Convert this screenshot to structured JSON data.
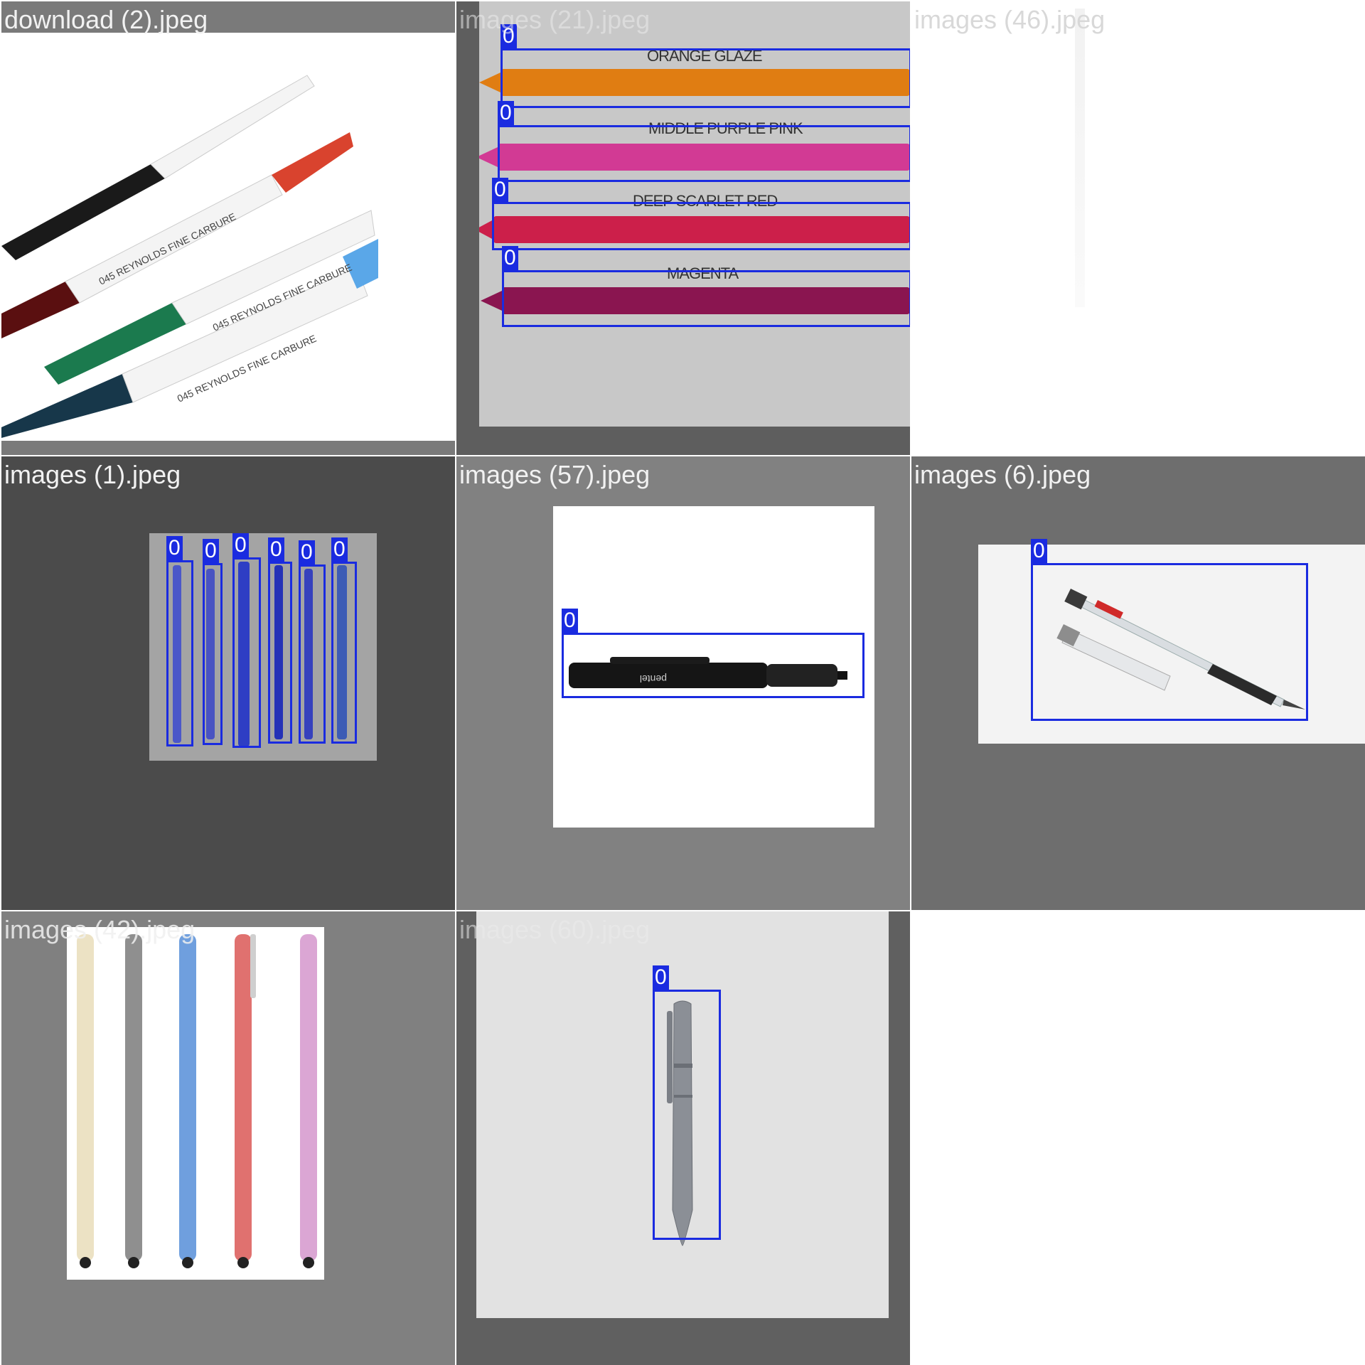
{
  "tiles": [
    {
      "filename": "download (2).jpeg",
      "boxes": []
    },
    {
      "filename": "images (21).jpeg",
      "boxes": [
        "0",
        "0",
        "0",
        "0"
      ],
      "pen_names": [
        "ORANGE GLAZE",
        "MIDDLE PURPLE PINK",
        "DEEP SCARLET RED",
        "MAGENTA"
      ]
    },
    {
      "filename": "images (46).jpeg",
      "boxes": []
    },
    {
      "filename": "images (1).jpeg",
      "boxes": [
        "0",
        "0",
        "0",
        "0",
        "0",
        "0"
      ]
    },
    {
      "filename": "images (57).jpeg",
      "boxes": [
        "0"
      ]
    },
    {
      "filename": "images (6).jpeg",
      "boxes": [
        "0"
      ]
    },
    {
      "filename": "images (42).jpeg",
      "boxes": []
    },
    {
      "filename": "images (60).jpeg",
      "boxes": [
        "0"
      ]
    }
  ],
  "colors": {
    "box": "#1a2be0"
  }
}
